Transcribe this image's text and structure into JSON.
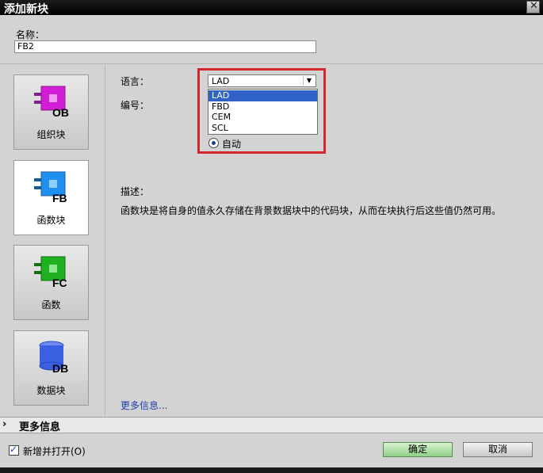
{
  "window": {
    "title": "添加新块"
  },
  "name": {
    "label": "名称：",
    "value": "FB2"
  },
  "blocks": [
    {
      "label": "组织块",
      "code": "OB",
      "color": "#d21fd6"
    },
    {
      "label": "函数块",
      "code": "FB",
      "color": "#1f8ff0"
    },
    {
      "label": "函数",
      "code": "FC",
      "color": "#1fb11f"
    },
    {
      "label": "数据块",
      "code": "DB",
      "color": "#3a5fe0"
    }
  ],
  "language": {
    "label": "语言：",
    "selected": "LAD",
    "options": [
      "LAD",
      "FBD",
      "CEM",
      "SCL"
    ]
  },
  "number": {
    "label": "编号：",
    "radio_label": "自动"
  },
  "description": {
    "title": "描述：",
    "text": "函数块是将自身的值永久存储在背景数据块中的代码块，从而在块执行后这些值仍然可用。"
  },
  "more_info_link": "更多信息...",
  "info_bar": {
    "label": "更多信息"
  },
  "footer": {
    "add_open_label": "新增并打开(O)",
    "ok_label": "确定",
    "cancel_label": "取消"
  }
}
